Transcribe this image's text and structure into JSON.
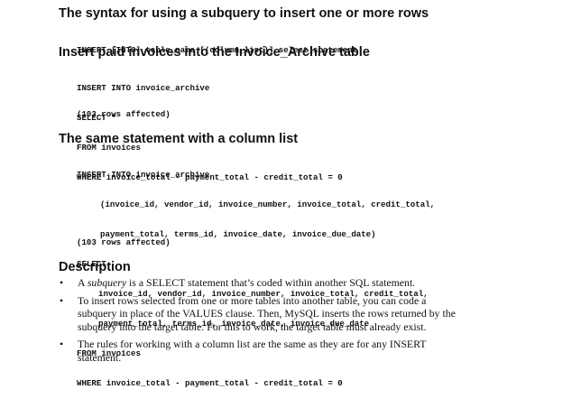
{
  "syntax_heading": "The syntax for using a subquery to insert one or more rows",
  "syntax_code": "INSERT [INTO] table_name [(column_list)] select_statement",
  "example1": {
    "heading": "Insert paid invoices into the Invoice_Archive table",
    "lines": [
      "INSERT INTO invoice_archive",
      "SELECT *",
      "FROM invoices",
      "WHERE invoice_total - payment_total - credit_total = 0"
    ],
    "result": "(103 rows affected)"
  },
  "example2": {
    "heading": "The same statement with a column list",
    "lines": [
      "INSERT INTO invoice_archive",
      "(invoice_id, vendor_id, invoice_number, invoice_total, credit_total,",
      "payment_total, terms_id, invoice_date, invoice_due_date)",
      "SELECT",
      "invoice_id, vendor_id, invoice_number, invoice_total, credit_total,",
      "payment_total, terms_id, invoice_date, invoice_due_date",
      "FROM invoices",
      "WHERE invoice_total - payment_total - credit_total = 0"
    ],
    "result": "(103 rows affected)"
  },
  "description": {
    "heading": "Description",
    "bullet_glyph": "•",
    "b1_pre": "A ",
    "b1_em": "subquery",
    "b1_post": " is a SELECT statement that’s coded within another SQL statement.",
    "b2": "To insert rows selected from one or more tables into another table, you can code a subquery in place of the VALUES clause. Then, MySQL inserts the rows returned by the subquery into the target table. For this to work, the target table must already exist.",
    "b3": "The rules for working with a column list are the same as they are for any INSERT statement."
  }
}
